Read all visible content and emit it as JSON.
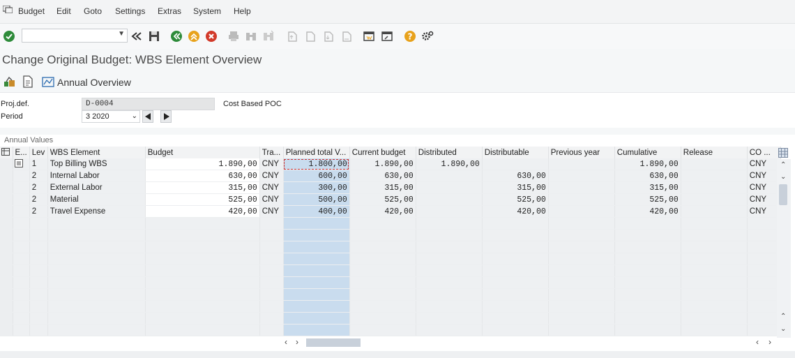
{
  "menubar": {
    "items": [
      "Budget",
      "Edit",
      "Goto",
      "Settings",
      "Extras",
      "System",
      "Help"
    ]
  },
  "toolbar": {
    "command_field_value": "",
    "icons": [
      "confirm-icon",
      "command-dropdown-icon",
      "rewind-icon",
      "save-icon",
      "back-icon",
      "exit-icon",
      "cancel-icon",
      "print-icon",
      "find-icon",
      "find-next-icon",
      "first-page-icon",
      "previous-page-icon",
      "next-page-icon",
      "last-page-icon",
      "new-session-icon",
      "shortcut-icon",
      "help-icon",
      "settings-icon"
    ]
  },
  "page": {
    "title": "Change Original Budget: WBS Element Overview"
  },
  "app_toolbar": {
    "annual_overview_label": "Annual Overview"
  },
  "header": {
    "proj_def_label": "Proj.def.",
    "proj_def_value": "D-0004",
    "proj_def_desc": "Cost Based POC",
    "period_label": "Period",
    "period_value": "3 2020"
  },
  "grid": {
    "section_title": "Annual Values",
    "columns": [
      "E...",
      "Lev",
      "WBS Element",
      "Budget",
      "Tra...",
      "Planned total V...",
      "Current budget",
      "Distributed",
      "Distributable",
      "Previous year",
      "Cumulative",
      "Release",
      "CO ..."
    ],
    "rows": [
      {
        "lev": "1",
        "wbs": "Top Billing WBS",
        "budget": "1.890,00",
        "tra": "CNY",
        "planned": "1.800,00",
        "current": "1.890,00",
        "distributed": "1.890,00",
        "distributable": "",
        "previous": "",
        "cumulative": "1.890,00",
        "release": "",
        "co": "CNY"
      },
      {
        "lev": "2",
        "wbs": "Internal Labor",
        "budget": "630,00",
        "tra": "CNY",
        "planned": "600,00",
        "current": "630,00",
        "distributed": "",
        "distributable": "630,00",
        "previous": "",
        "cumulative": "630,00",
        "release": "",
        "co": "CNY"
      },
      {
        "lev": "2",
        "wbs": "External Labor",
        "budget": "315,00",
        "tra": "CNY",
        "planned": "300,00",
        "current": "315,00",
        "distributed": "",
        "distributable": "315,00",
        "previous": "",
        "cumulative": "315,00",
        "release": "",
        "co": "CNY"
      },
      {
        "lev": "2",
        "wbs": "Material",
        "budget": "525,00",
        "tra": "CNY",
        "planned": "500,00",
        "current": "525,00",
        "distributed": "",
        "distributable": "525,00",
        "previous": "",
        "cumulative": "525,00",
        "release": "",
        "co": "CNY"
      },
      {
        "lev": "2",
        "wbs": "Travel Expense",
        "budget": "420,00",
        "tra": "CNY",
        "planned": "400,00",
        "current": "420,00",
        "distributed": "",
        "distributable": "420,00",
        "previous": "",
        "cumulative": "420,00",
        "release": "",
        "co": "CNY"
      }
    ],
    "empty_rows": 10
  },
  "colors": {
    "selected_column": "#c9dcee",
    "accent_green": "#2e8b3a",
    "accent_orange": "#e8a21c",
    "accent_red": "#d23a2a"
  }
}
